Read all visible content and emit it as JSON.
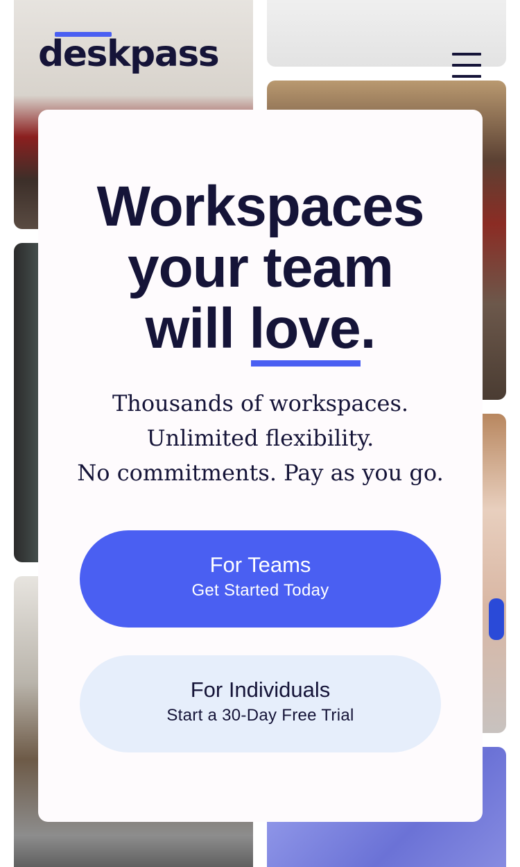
{
  "brand": {
    "logo_text": "deskpass",
    "accent_color": "#4a5ff2",
    "ink_color": "#151438"
  },
  "header": {
    "menu_icon": "hamburger-menu-icon"
  },
  "hero": {
    "headline": {
      "line1": "Workspaces",
      "line2": "your team",
      "line3_prefix": "will ",
      "line3_emphasis": "love",
      "line3_suffix": "."
    },
    "subtext": {
      "line1": "Thousands of workspaces.",
      "line2": "Unlimited flexibility.",
      "line3": "No commitments. Pay as you go."
    }
  },
  "cta": {
    "teams": {
      "title": "For Teams",
      "subtitle": "Get Started Today"
    },
    "individuals": {
      "title": "For Individuals",
      "subtitle": "Start a 30-Day Free Trial"
    }
  }
}
